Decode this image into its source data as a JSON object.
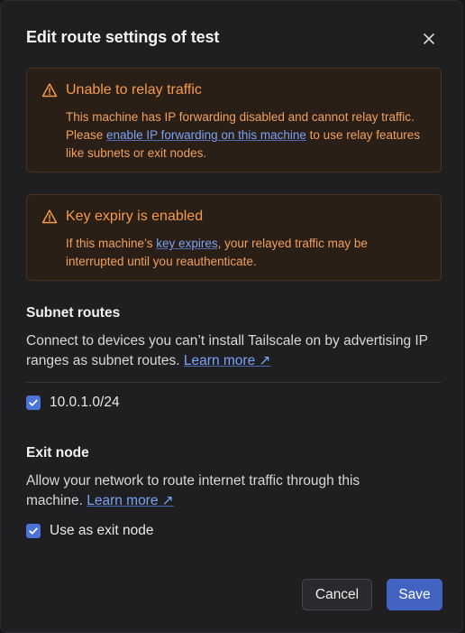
{
  "dialog": {
    "title": "Edit route settings of test"
  },
  "alerts": [
    {
      "title": "Unable to relay traffic",
      "body_1": "This machine has IP forwarding disabled and cannot relay traffic. Please ",
      "link": "enable IP forwarding on this machine",
      "body_2": " to use relay features like subnets or exit nodes."
    },
    {
      "title": "Key expiry is enabled",
      "body_1": "If this machine’s ",
      "link": "key expires",
      "body_2": ", your relayed traffic may be interrupted until you reauthenticate."
    }
  ],
  "subnet": {
    "title": "Subnet routes",
    "text": "Connect to devices you can’t install Tailscale on by advertising IP ranges as subnet routes. ",
    "learn_more": "Learn more ↗",
    "routes": [
      {
        "label": "10.0.1.0/24",
        "checked": true
      }
    ]
  },
  "exit_node": {
    "title": "Exit node",
    "text": "Allow your network to route internet traffic through this machine. ",
    "learn_more": "Learn more ↗",
    "checkbox_label": "Use as exit node",
    "checked": true
  },
  "buttons": {
    "cancel": "Cancel",
    "save": "Save"
  },
  "colors": {
    "warning": "#f59a4a",
    "link": "#7aa3f5",
    "primary": "#4263c2"
  },
  "icons": {
    "close": "close-icon",
    "warning": "warning-icon",
    "check": "check-icon"
  }
}
